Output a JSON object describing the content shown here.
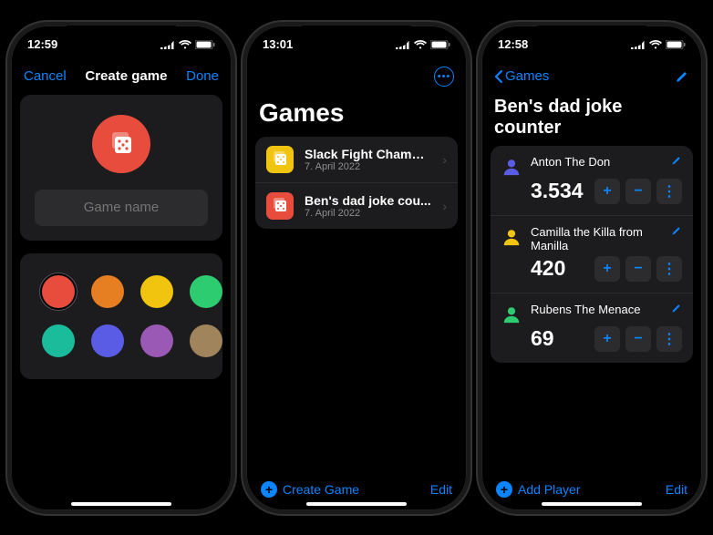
{
  "screen1": {
    "time": "12:59",
    "nav": {
      "cancel": "Cancel",
      "title": "Create game",
      "done": "Done"
    },
    "form": {
      "placeholder": "Game name"
    },
    "colors": [
      "#e74c3c",
      "#e67e22",
      "#f1c40f",
      "#2ecc71",
      "#1abc9c",
      "#5b5ce6",
      "#9b59b6",
      "#a0845c"
    ],
    "selected_color_index": 0
  },
  "screen2": {
    "time": "13:01",
    "title": "Games",
    "games": [
      {
        "name": "Slack Fight Champi...",
        "date": "7. April 2022",
        "color": "#f1c40f"
      },
      {
        "name": "Ben's dad joke cou...",
        "date": "7. April 2022",
        "color": "#e74c3c"
      }
    ],
    "bottom": {
      "create": "Create Game",
      "edit": "Edit"
    }
  },
  "screen3": {
    "time": "12:58",
    "nav": {
      "back": "Games"
    },
    "title": "Ben's dad joke counter",
    "players": [
      {
        "name": "Anton The Don",
        "score": "3.534",
        "avatar_color": "#5b5ce6"
      },
      {
        "name": "Camilla the Killa from Manilla",
        "score": "420",
        "avatar_color": "#f1c40f"
      },
      {
        "name": "Rubens The Menace",
        "score": "69",
        "avatar_color": "#2ecc71"
      }
    ],
    "bottom": {
      "add": "Add Player",
      "edit": "Edit"
    }
  }
}
